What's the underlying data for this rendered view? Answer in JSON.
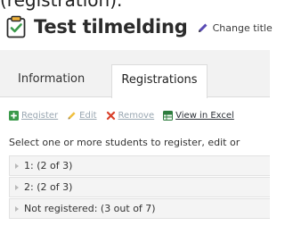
{
  "partial_heading": "(registration).",
  "header": {
    "title": "Test tilmelding",
    "change_title_label": "Change title"
  },
  "tabs": [
    {
      "label": "Information",
      "active": false
    },
    {
      "label": "Registrations",
      "active": true
    }
  ],
  "toolbar": {
    "register_label": "Register",
    "edit_label": "Edit",
    "remove_label": "Remove",
    "excel_label": "View in Excel"
  },
  "instruction": "Select one or more students to register, edit or",
  "groups": [
    {
      "label": "1: (2 of 3)"
    },
    {
      "label": "2: (2 of 3)"
    },
    {
      "label": "Not registered: (3 out of 7)"
    }
  ],
  "colors": {
    "accent_green": "#3a9a4a",
    "remove_red": "#d9412b",
    "disabled_text": "#9aa7b2",
    "tabs_bg": "#f2f2f2"
  }
}
